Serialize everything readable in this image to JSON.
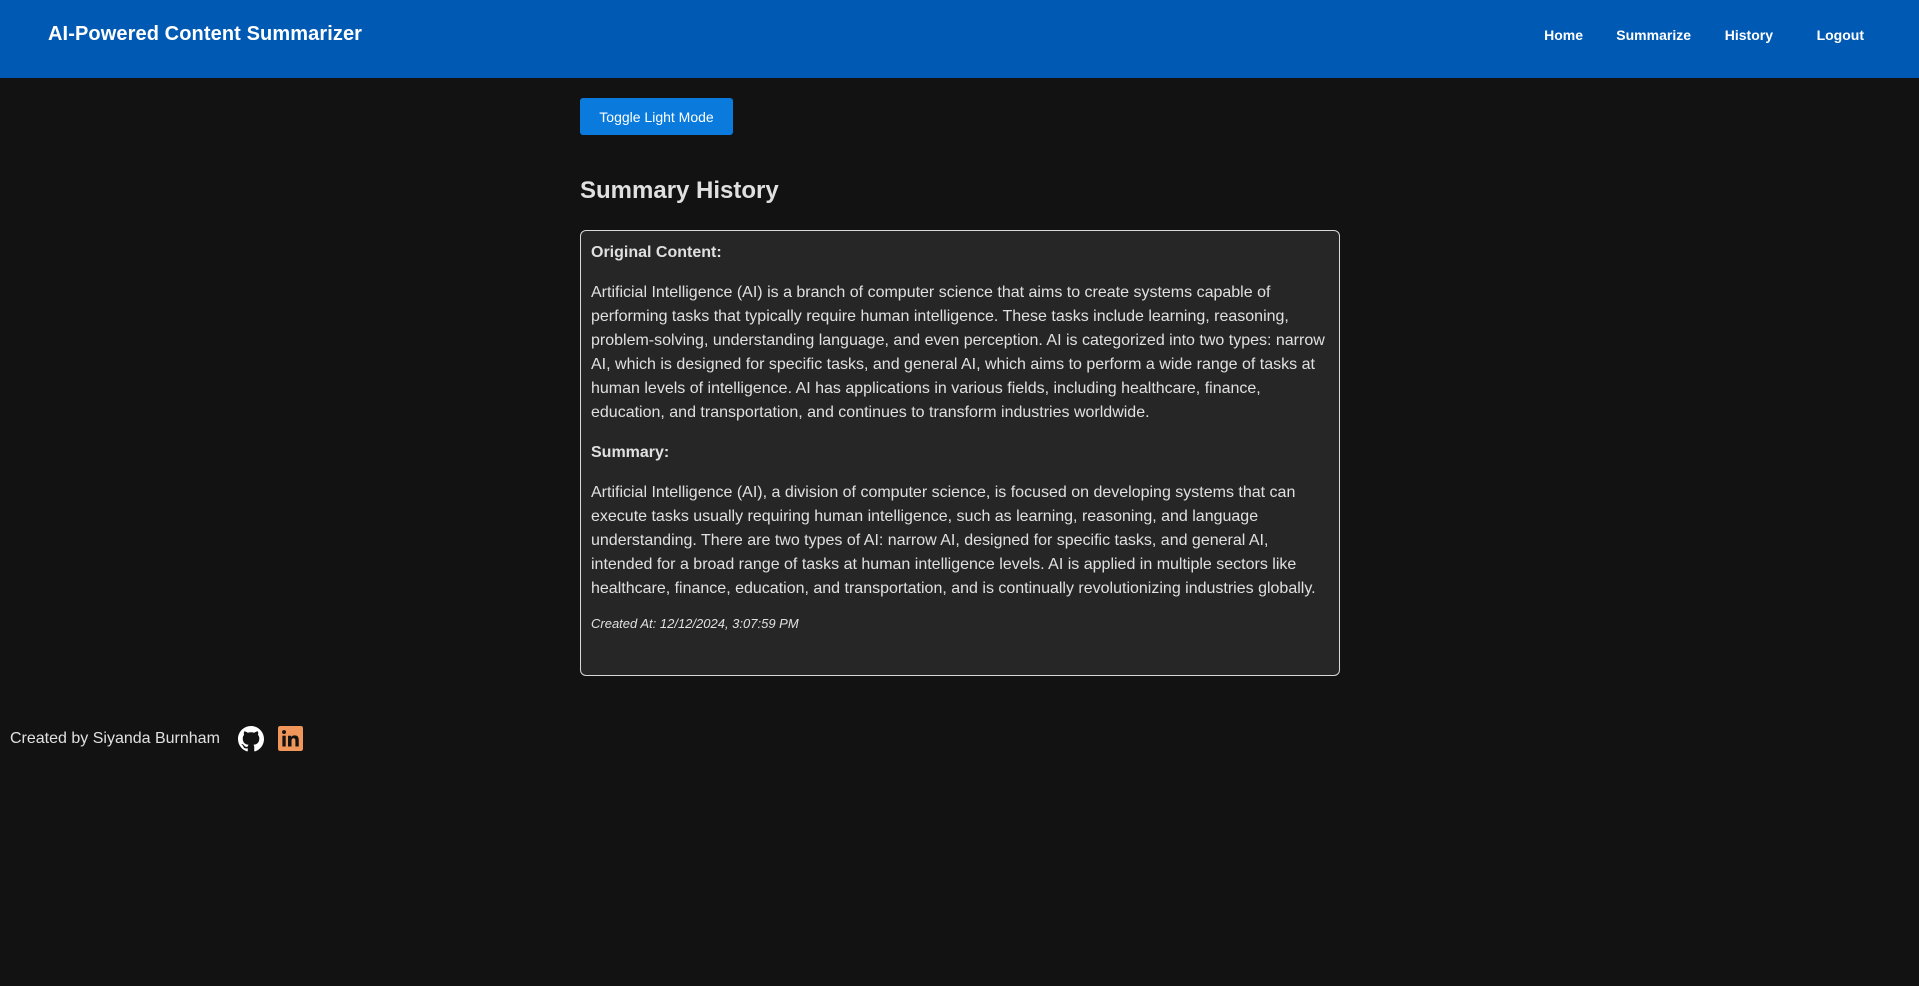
{
  "navbar": {
    "brand": "AI-Powered Content Summarizer",
    "links": [
      "Home",
      "Summarize",
      "History",
      "Logout"
    ]
  },
  "toggle_label": "Toggle Light Mode",
  "page_title": "Summary History",
  "history": [
    {
      "original_label": "Original Content:",
      "original_text": "Artificial Intelligence (AI) is a branch of computer science that aims to create systems capable of performing tasks that typically require human intelligence. These tasks include learning, reasoning, problem-solving, understanding language, and even perception. AI is categorized into two types: narrow AI, which is designed for specific tasks, and general AI, which aims to perform a wide range of tasks at human levels of intelligence. AI has applications in various fields, including healthcare, finance, education, and transportation, and continues to transform industries worldwide.",
      "summary_label": "Summary:",
      "summary_text": "Artificial Intelligence (AI), a division of computer science, is focused on developing systems that can execute tasks usually requiring human intelligence, such as learning, reasoning, and language understanding. There are two types of AI: narrow AI, designed for specific tasks, and general AI, intended for a broad range of tasks at human intelligence levels. AI is applied in multiple sectors like healthcare, finance, education, and transportation, and is continually revolutionizing industries globally.",
      "created_at": "Created At: 12/12/2024, 3:07:59 PM"
    }
  ],
  "footer": {
    "credit": "Created by Siyanda Burnham",
    "icons": [
      "github-icon",
      "linkedin-icon"
    ]
  },
  "colors": {
    "navbar_bg": "#0059b3",
    "page_bg": "#121212",
    "button_bg": "#0a7bdc",
    "card_bg": "#262626",
    "linkedin_accent": "#f0965a"
  }
}
